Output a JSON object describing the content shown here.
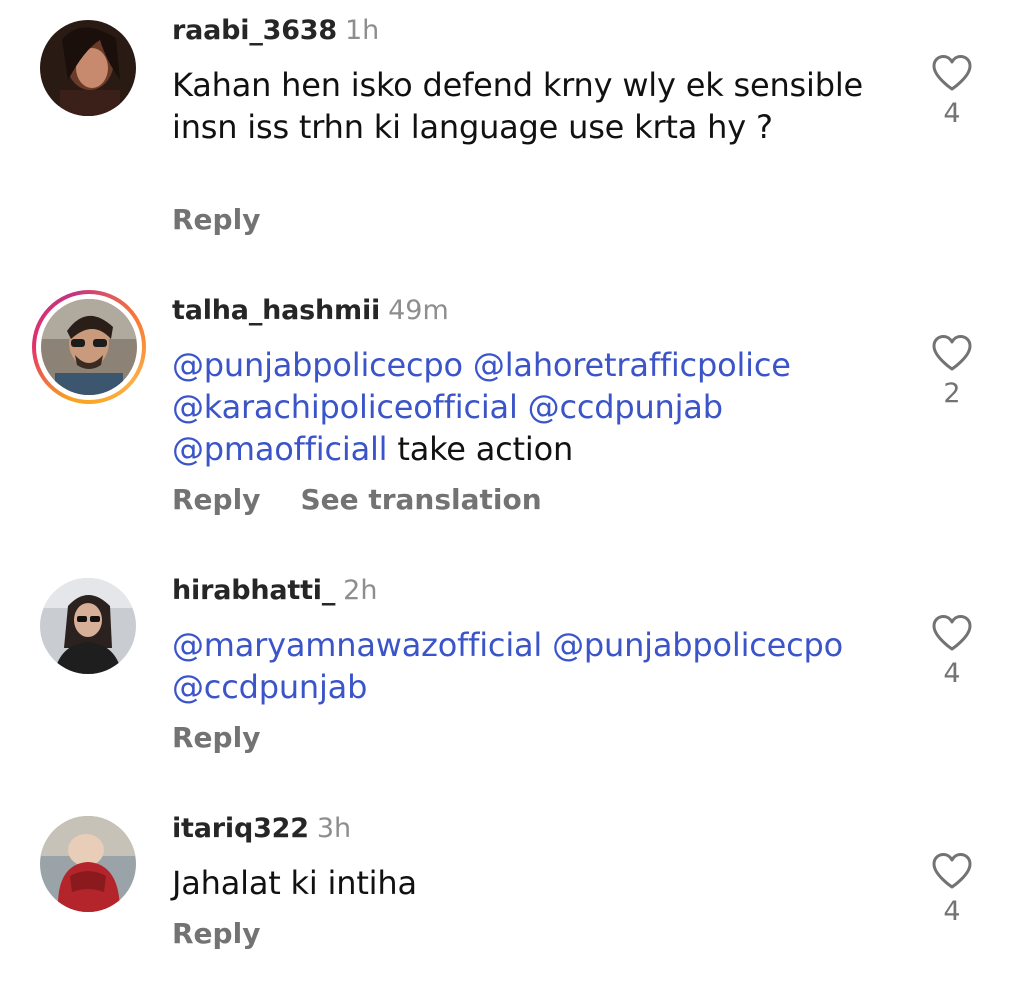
{
  "comments": [
    {
      "username": "raabi_3638",
      "time": "1h",
      "text": [
        {
          "t": "Kahan hen isko defend krny wly ek sensible insn iss trhn ki language use krta hy ?",
          "mention": false
        }
      ],
      "reply_label": "Reply",
      "likes": "4",
      "avatar_icon": "avatar-photo"
    },
    {
      "username": "talha_hashmii",
      "time": "49m",
      "text": [
        {
          "t": "@punjabpolicecpo",
          "mention": true
        },
        {
          "t": " ",
          "mention": false
        },
        {
          "t": "@lahoretrafficpolice",
          "mention": true
        },
        {
          "t": " ",
          "mention": false
        },
        {
          "t": "@karachipoliceofficial",
          "mention": true
        },
        {
          "t": " ",
          "mention": false
        },
        {
          "t": "@ccdpunjab",
          "mention": true
        },
        {
          "t": " ",
          "mention": false
        },
        {
          "t": "@pmaofficiall",
          "mention": true
        },
        {
          "t": "  take action",
          "mention": false
        }
      ],
      "reply_label": "Reply",
      "translation_label": "See translation",
      "likes": "2",
      "avatar_icon": "avatar-photo",
      "has_story": true
    },
    {
      "username": "hirabhatti_",
      "time": "2h",
      "text": [
        {
          "t": "@maryamnawazofficial",
          "mention": true
        },
        {
          "t": " ",
          "mention": false
        },
        {
          "t": "@punjabpolicecpo",
          "mention": true
        },
        {
          "t": " ",
          "mention": false
        },
        {
          "t": "@ccdpunjab",
          "mention": true
        }
      ],
      "reply_label": "Reply",
      "likes": "4",
      "avatar_icon": "avatar-photo"
    },
    {
      "username": "itariq322",
      "time": "3h",
      "text": [
        {
          "t": "Jahalat ki intiha",
          "mention": false
        }
      ],
      "reply_label": "Reply",
      "likes": "4",
      "avatar_icon": "avatar-photo"
    }
  ],
  "colors": {
    "mention": "#3b55c9",
    "username": "#262626",
    "muted": "#8e8e8e",
    "action": "#737373"
  },
  "icons": {
    "like": "heart-outline-icon"
  }
}
